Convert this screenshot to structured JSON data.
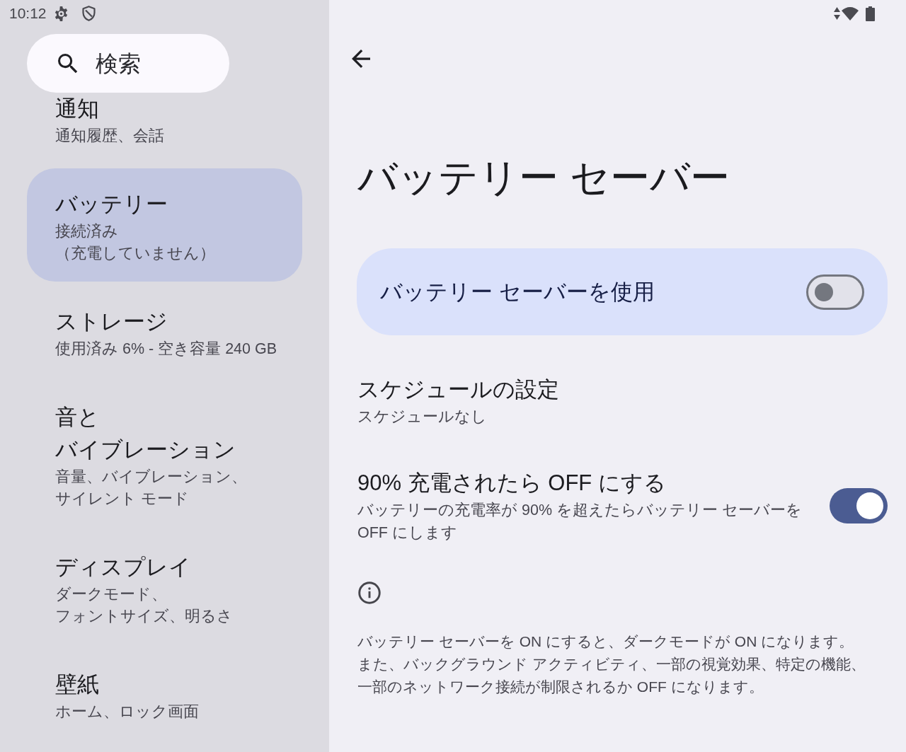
{
  "status_bar": {
    "time": "10:12"
  },
  "sidebar": {
    "search": {
      "label": "検索"
    },
    "items": [
      {
        "title": [
          "通知"
        ],
        "summary": [
          "通知履歴、会話"
        ],
        "selected": false
      },
      {
        "title": [
          "バッテリー"
        ],
        "summary": [
          "接続済み",
          "（充電していません）"
        ],
        "selected": true
      },
      {
        "title": [
          "ストレージ"
        ],
        "summary": [
          "使用済み 6% - 空き容量 240 GB"
        ],
        "selected": false
      },
      {
        "title": [
          "音と",
          "バイブレーション"
        ],
        "summary": [
          "音量、バイブレーション、",
          "サイレント モード"
        ],
        "selected": false
      },
      {
        "title": [
          "ディスプレイ"
        ],
        "summary": [
          "ダークモード、",
          "フォントサイズ、明るさ"
        ],
        "selected": false
      },
      {
        "title": [
          "壁紙"
        ],
        "summary": [
          "ホーム、ロック画面"
        ],
        "selected": false
      }
    ]
  },
  "page": {
    "title": "バッテリー セーバー",
    "main_switch": {
      "label": "バッテリー セーバーを使用",
      "on": false
    },
    "settings": [
      {
        "kind": "link",
        "title": "スケジュールの設定",
        "summary": "スケジュールなし"
      },
      {
        "kind": "switch",
        "title": "90% 充電されたら OFF にする",
        "summary": "バッテリーの充電率が 90% を超えたらバッテリー セーバーを OFF にします",
        "on": true
      }
    ],
    "footer": {
      "text": "バッテリー セーバーを ON にすると、ダークモードが ON になります。また、バックグラウンド アクティビティ、一部の視覚効果、特定の機能、一部のネットワーク接続が制限されるか OFF になります。"
    }
  }
}
